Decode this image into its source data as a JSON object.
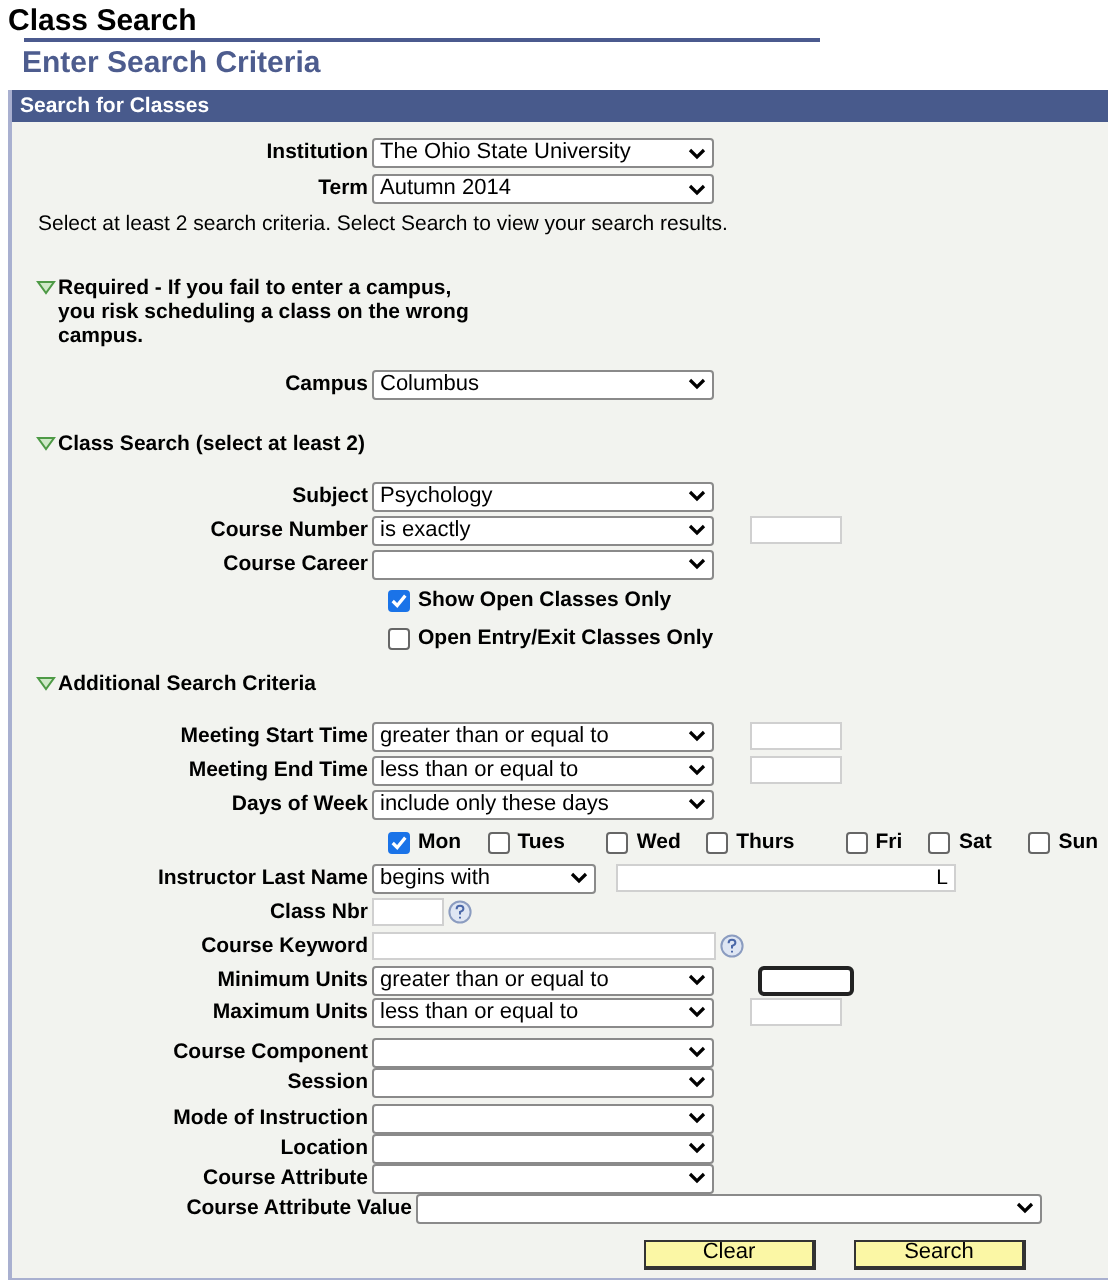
{
  "page_title": "Class Search",
  "subtitle": "Enter Search Criteria",
  "panel_title": "Search for Classes",
  "top_fields": [
    {
      "kind": "select",
      "label": "Institution",
      "value": "The Ohio State University"
    },
    {
      "kind": "select",
      "label": "Term",
      "value": "Autumn 2014"
    }
  ],
  "instructions": "Select at least 2 search criteria. Select Search to view your search results.",
  "groups": [
    {
      "heading": "Required - If you fail to enter a campus, you risk scheduling a class on the wrong campus.",
      "expanded": true,
      "fields": [
        {
          "kind": "select",
          "label": "Campus",
          "value": "Columbus"
        }
      ]
    },
    {
      "heading": "Class Search (select at least 2)",
      "expanded": true,
      "fields": [
        {
          "kind": "select",
          "label": "Subject",
          "value": "Psychology"
        },
        {
          "kind": "select_input",
          "label": "Course Number",
          "value": "is exactly",
          "focused": false
        },
        {
          "kind": "select",
          "label": "Course Career"
        },
        {
          "kind": "checkbox",
          "label": "Show Open Classes Only",
          "checked": true
        },
        {
          "kind": "checkbox",
          "label": "Open Entry/Exit Classes Only",
          "checked": false
        }
      ]
    },
    {
      "heading": "Additional Search Criteria",
      "expanded": true,
      "fields": [
        {
          "kind": "select_input",
          "label": "Meeting Start Time",
          "value": "greater than or equal to",
          "focused": false
        },
        {
          "kind": "select_input",
          "label": "Meeting End Time",
          "value": "less than or equal to",
          "focused": false
        },
        {
          "kind": "select",
          "label": "Days of Week",
          "value": "include only these days"
        },
        {
          "kind": "days",
          "days": [
            {
              "label": "Mon",
              "checked": true
            },
            {
              "label": "Tues",
              "checked": false
            },
            {
              "label": "Wed",
              "checked": false
            },
            {
              "label": "Thurs",
              "checked": false
            },
            {
              "label": "Fri",
              "checked": false
            },
            {
              "label": "Sat",
              "checked": false
            },
            {
              "label": "Sun",
              "checked": false
            }
          ]
        },
        {
          "kind": "select_text",
          "label": "Instructor Last Name",
          "value": "begins with",
          "text": "L"
        },
        {
          "kind": "short_text_help",
          "label": "Class Nbr"
        },
        {
          "kind": "text_help",
          "label": "Course Keyword"
        },
        {
          "kind": "select_input",
          "label": "Minimum Units",
          "value": "greater than or equal to",
          "focused": true
        },
        {
          "kind": "select_input",
          "label": "Maximum Units",
          "value": "less than or equal to",
          "focused": false
        },
        {
          "kind": "select",
          "label": "Course Component"
        },
        {
          "kind": "select",
          "label": "Session"
        },
        {
          "kind": "select",
          "label": "Mode of Instruction"
        },
        {
          "kind": "select",
          "label": "Location"
        },
        {
          "kind": "select",
          "label": "Course Attribute"
        },
        {
          "kind": "wide_select",
          "label": "Course Attribute Value"
        }
      ]
    }
  ],
  "buttons": [
    {
      "label": "Clear"
    },
    {
      "label": "Search"
    }
  ]
}
